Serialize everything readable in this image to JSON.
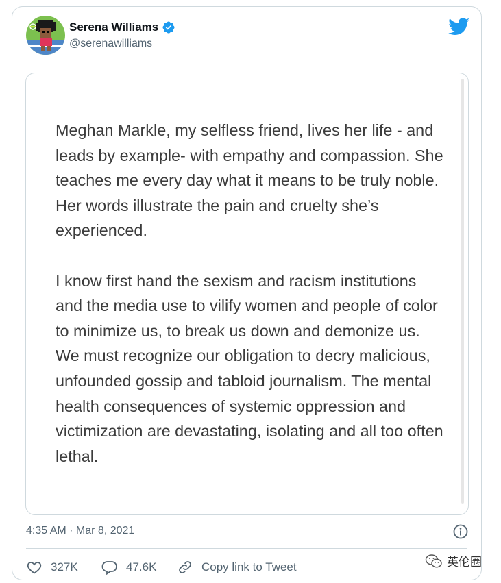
{
  "author": {
    "display_name": "Serena Williams",
    "handle": "@serenawilliams",
    "avatar_icon": "pixel-art-avatar",
    "verified_icon": "verified-badge-icon",
    "verified_color": "#1d9bf0"
  },
  "brand": {
    "icon": "twitter-bird-icon",
    "color": "#1d9bf0"
  },
  "statement": {
    "paragraph_1": "Meghan Markle, my selfless friend, lives her life - and leads by example- with empathy and compassion. She teaches me every day what it means to be truly noble. Her words illustrate the pain and cruelty she’s experienced.",
    "paragraph_2": "I know first hand the sexism and racism institutions and the media use to vilify women and people of color to minimize us, to break us down and demonize us. We must recognize our obligation to decry malicious, unfounded gossip and tabloid journalism. The mental health consequences of systemic oppression and victimization are devastating, isolating and all too often lethal."
  },
  "meta": {
    "timestamp": "4:35 AM · Mar 8, 2021",
    "info_icon": "info-icon"
  },
  "actions": {
    "likes": "327K",
    "replies": "47.6K",
    "copy_link": "Copy link to Tweet"
  },
  "watermark": {
    "text": "英伦圈",
    "icon": "wechat-icon"
  }
}
